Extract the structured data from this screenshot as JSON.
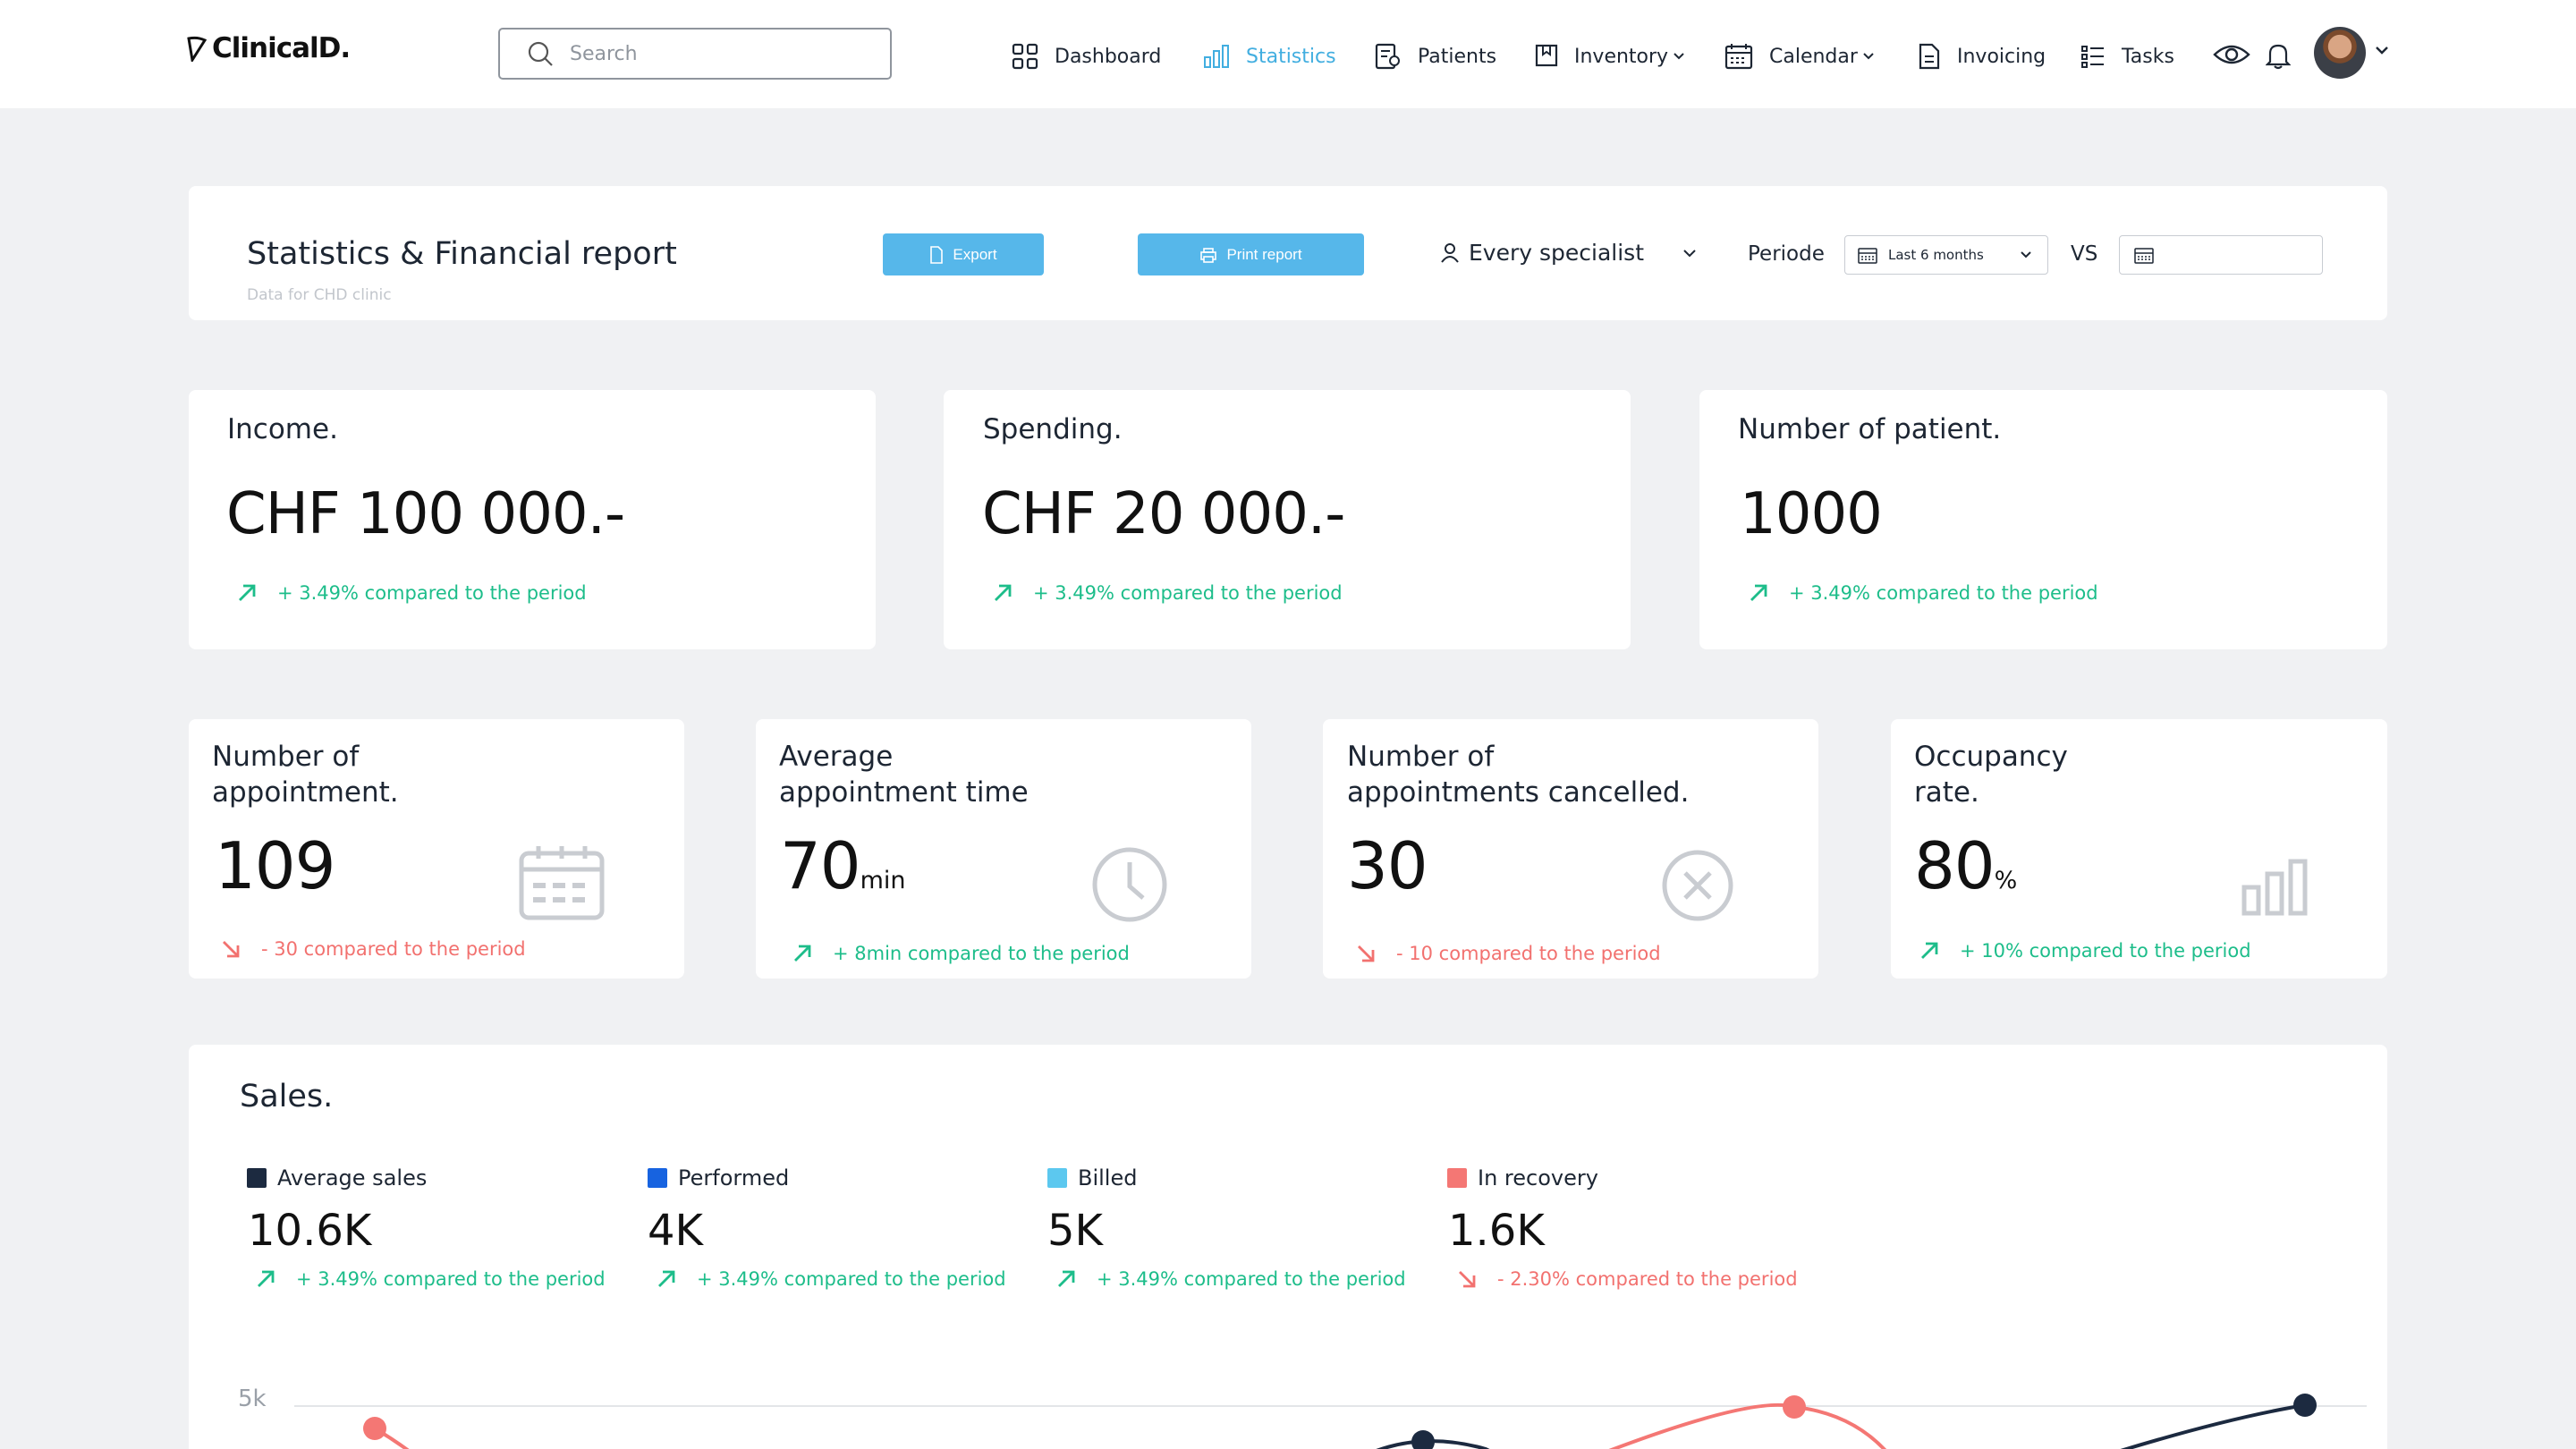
{
  "nav": {
    "logo": "ClinicalD.",
    "search_placeholder": "Search",
    "items": [
      {
        "label": "Dashboard"
      },
      {
        "label": "Statistics",
        "active": true
      },
      {
        "label": "Patients"
      },
      {
        "label": "Inventory"
      },
      {
        "label": "Calendar"
      },
      {
        "label": "Invoicing"
      },
      {
        "label": "Tasks"
      }
    ]
  },
  "report": {
    "title": "Statistics & Financial report",
    "subtitle": "Data for CHD clinic",
    "export_label": "Export",
    "print_label": "Print report",
    "specialist": "Every specialist",
    "periode_label": "Periode",
    "period_value": "Last 6 months",
    "vs_label": "VS"
  },
  "kpis": [
    {
      "title": "Income.",
      "value": "CHF 100 000.-",
      "delta": "+ 3.49% compared to the period",
      "trend": "up"
    },
    {
      "title": "Spending.",
      "value": "CHF 20 000.-",
      "delta": "+ 3.49% compared to the period",
      "trend": "up"
    },
    {
      "title": "Number of patient.",
      "value": "1000",
      "delta": "+ 3.49% compared to the period",
      "trend": "up"
    }
  ],
  "stats": [
    {
      "title_1": "Number of",
      "title_2": "appointment.",
      "value": "109",
      "unit": "",
      "delta": "- 30 compared to the period",
      "trend": "down",
      "icon": "calendar-icon"
    },
    {
      "title_1": "Average",
      "title_2": "appointment time",
      "value": "70",
      "unit": "min",
      "delta": "+ 8min compared to the period",
      "trend": "up",
      "icon": "clock-icon"
    },
    {
      "title_1": "Number of",
      "title_2": "appointments cancelled.",
      "value": "30",
      "unit": "",
      "delta": "- 10 compared to the period",
      "trend": "down",
      "icon": "cancel-icon"
    },
    {
      "title_1": "Occupancy",
      "title_2": "rate.",
      "value": "80",
      "unit": "%",
      "delta": "+ 10% compared to the period",
      "trend": "up",
      "icon": "bar-chart-icon"
    }
  ],
  "sales": {
    "title": "Sales.",
    "items": [
      {
        "label": "Average sales",
        "color": "#1c2a40",
        "value": "10.6K",
        "delta": "+ 3.49% compared to the period",
        "trend": "up"
      },
      {
        "label": "Performed",
        "color": "#1763e0",
        "value": "4K",
        "delta": "+ 3.49% compared to the period",
        "trend": "up"
      },
      {
        "label": "Billed",
        "color": "#5cc8ef",
        "value": "5K",
        "delta": "+ 3.49% compared to the period",
        "trend": "up"
      },
      {
        "label": "In recovery",
        "color": "#f47774",
        "value": "1.6K",
        "delta": "- 2.30% compared to the period",
        "trend": "down"
      }
    ],
    "y_tick": "5k"
  },
  "colors": {
    "accent": "#42aee0",
    "up": "#1dbd8a",
    "down": "#f2716f"
  }
}
